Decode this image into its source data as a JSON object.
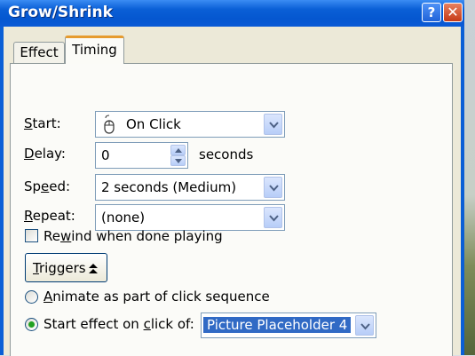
{
  "window": {
    "title": "Grow/Shrink",
    "help_glyph": "?",
    "close_glyph": "✕"
  },
  "tabs": [
    {
      "label": "Effect",
      "selected": false
    },
    {
      "label": "Timing",
      "selected": true
    }
  ],
  "timing": {
    "start": {
      "label_pre": "",
      "label_u": "S",
      "label_post": "tart:",
      "value": "On Click",
      "icon": "mouse-icon"
    },
    "delay": {
      "label_pre": "",
      "label_u": "D",
      "label_post": "elay:",
      "value": "0",
      "unit": "seconds"
    },
    "speed": {
      "label_pre": "Sp",
      "label_u": "e",
      "label_post": "ed:",
      "value": "2 seconds (Medium)"
    },
    "repeat": {
      "label_pre": "",
      "label_u": "R",
      "label_post": "epeat:",
      "value": "(none)"
    },
    "rewind": {
      "label_pre": "Re",
      "label_u": "w",
      "label_post": "ind when done playing",
      "checked": false
    },
    "triggers_button": {
      "label_pre": "",
      "label_u": "T",
      "label_post": "riggers",
      "icon": "collapse-arrows-icon"
    },
    "animate_sequence": {
      "label_pre": "",
      "label_u": "A",
      "label_post": "nimate as part of click sequence",
      "selected": false
    },
    "start_on_click": {
      "label_pre": "Start effect on ",
      "label_u": "c",
      "label_post": "lick of:",
      "selected": true,
      "value": "Picture Placeholder 4"
    }
  },
  "colors": {
    "title_bar": "#0a5fd6",
    "tab_highlight": "#e69b2e",
    "selection": "#316ac5",
    "radio_dot": "#21a121"
  }
}
